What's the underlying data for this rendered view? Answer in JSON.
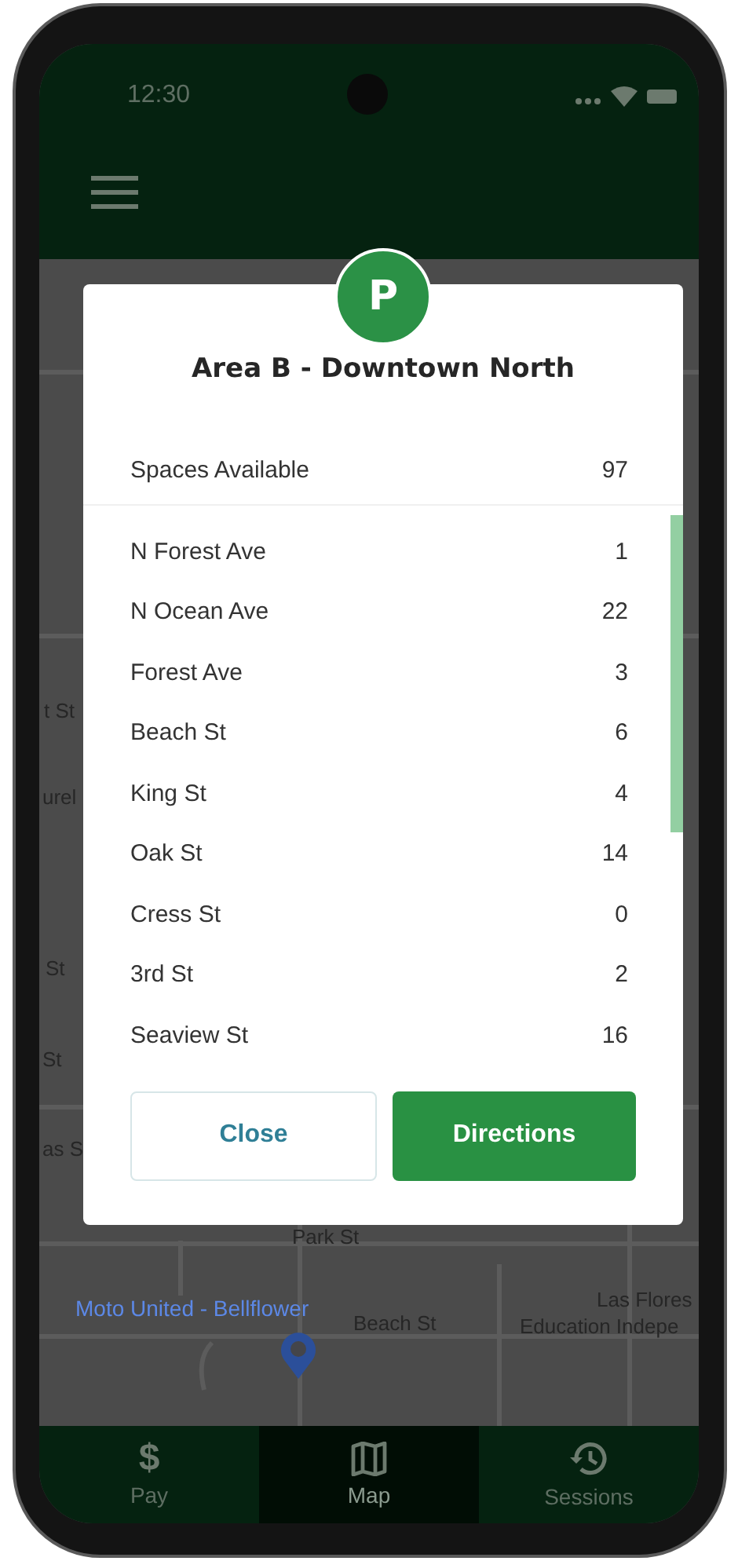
{
  "status_bar": {
    "time": "12:30"
  },
  "map": {
    "labels": [
      {
        "text": "t St",
        "kind": "street"
      },
      {
        "text": "urel",
        "kind": "street"
      },
      {
        "text": "St",
        "kind": "street"
      },
      {
        "text": "St",
        "kind": "street"
      },
      {
        "text": "as S",
        "kind": "street"
      },
      {
        "text": "Park St",
        "kind": "street"
      },
      {
        "text": "Moto United - Bellflower",
        "kind": "place"
      },
      {
        "text": "Beach St",
        "kind": "street"
      },
      {
        "text": "Las Flores",
        "kind": "street"
      },
      {
        "text": "Education Indepe",
        "kind": "street"
      }
    ]
  },
  "dialog": {
    "badge": "P",
    "title": "Area B - Downtown North",
    "summary": {
      "label": "Spaces Available",
      "value": "97"
    },
    "rows": [
      {
        "name": "N Forest Ave",
        "count": "1"
      },
      {
        "name": "N Ocean Ave",
        "count": "22"
      },
      {
        "name": "Forest Ave",
        "count": "3"
      },
      {
        "name": "Beach St",
        "count": "6"
      },
      {
        "name": "King St",
        "count": "4"
      },
      {
        "name": "Oak St",
        "count": "14"
      },
      {
        "name": "Cress St",
        "count": "0"
      },
      {
        "name": "3rd St",
        "count": "2"
      },
      {
        "name": "Seaview St",
        "count": "16"
      }
    ],
    "buttons": [
      {
        "label": "Close",
        "kind": "secondary"
      },
      {
        "label": "Directions",
        "kind": "primary"
      }
    ]
  },
  "nav": [
    {
      "label": "Pay",
      "icon": "$",
      "kind": "glyph",
      "selected": false
    },
    {
      "label": "Map",
      "kind": "map",
      "selected": true
    },
    {
      "label": "Sessions",
      "kind": "history",
      "selected": false
    }
  ]
}
